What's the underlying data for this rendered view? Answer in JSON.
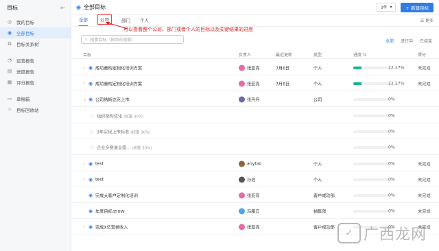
{
  "sidebar": {
    "title": "目标",
    "items": [
      {
        "label": "我的目标",
        "icon": "target-icon"
      },
      {
        "label": "全部目标",
        "icon": "goal-icon",
        "active": true
      },
      {
        "label": "目标关系树",
        "icon": "tree-icon"
      },
      {
        "label": "运营报告",
        "icon": "report-icon"
      },
      {
        "label": "进度报告",
        "icon": "progress-report-icon"
      },
      {
        "label": "评分报告",
        "icon": "score-report-icon"
      },
      {
        "label": "草稿箱",
        "icon": "draft-icon"
      },
      {
        "label": "目标回收站",
        "icon": "recycle-icon"
      }
    ]
  },
  "header": {
    "title": "全部目标",
    "period": "3年",
    "new_button": "+ 新建目标"
  },
  "tabs": [
    {
      "label": "全部",
      "active": true
    },
    {
      "label": "公司",
      "boxed": true
    },
    {
      "label": "部门"
    },
    {
      "label": "个人"
    }
  ],
  "more_label": "☰ 更多",
  "annotation": "可以查看整个公司、部门或者个人的目标以及关键结果的进度",
  "search": {
    "placeholder": "搜索目标（按回车搜索）"
  },
  "filters": [
    "全部",
    "进行中",
    "已结束"
  ],
  "columns": {
    "goal": "目标",
    "owner": "负责人",
    "updated": "最近更新",
    "type": "类型",
    "progress": "进度 ⇅",
    "score": "得分"
  },
  "rows": [
    {
      "name": "成功重构定制化培训方案",
      "owner": "张亚亮",
      "avatar_color": "#e86aa8",
      "updated": "7月6日",
      "type": "个人",
      "progress": 22.27,
      "progress_label": "22.27%",
      "status": "未完成",
      "kind": "goal",
      "expand": true
    },
    {
      "name": "成功重构定制化培训方案",
      "owner": "张亚亮",
      "avatar_color": "#e86aa8",
      "updated": "7月6日",
      "type": "个人",
      "progress": 22.27,
      "progress_label": "22.27%",
      "status": "未完成",
      "kind": "goal",
      "expand": true
    },
    {
      "name": "公司纳斯达克上市",
      "owner": "张丹丹",
      "avatar_color": "#6b6aa8",
      "updated": "",
      "type": "公司",
      "progress": 0,
      "progress_label": "0%",
      "status": "",
      "kind": "goal",
      "expand": true,
      "open": true
    },
    {
      "name": "组织架构优化",
      "sub": "(权重 30%)",
      "owner": "",
      "avatar_color": "",
      "updated": "",
      "type": "",
      "progress": 0,
      "progress_label": "0%",
      "status": "",
      "kind": "kr"
    },
    {
      "name": "3年实现上市标准",
      "sub": "(权重 30%)",
      "owner": "",
      "avatar_color": "",
      "updated": "",
      "type": "",
      "progress": 0,
      "progress_label": "0%",
      "status": "",
      "kind": "kr"
    },
    {
      "name": "企业多赛道全面...",
      "sub": "(权重 30%)",
      "owner": "",
      "avatar_color": "",
      "updated": "",
      "type": "",
      "progress": 0,
      "progress_label": "0%",
      "status": "",
      "kind": "kr"
    },
    {
      "name": "test",
      "owner": "anytao",
      "avatar_color": "#8a6a3a",
      "updated": "",
      "type": "个人",
      "progress": 0,
      "progress_label": "0%",
      "status": "未完成",
      "kind": "goal",
      "expand": true
    },
    {
      "name": "test",
      "owner": "孙浩",
      "avatar_color": "#555555",
      "updated": "",
      "type": "个人",
      "progress": 0,
      "progress_label": "0%",
      "status": "未完成",
      "kind": "goal",
      "expand": true
    },
    {
      "name": "完成大客户定制化培训",
      "owner": "张亚亮",
      "avatar_color": "#e86aa8",
      "updated": "",
      "type": "客户成功部",
      "progress": 0,
      "progress_label": "0%",
      "status": "未完成",
      "kind": "goal",
      "expand": false
    },
    {
      "name": "年度目标450W",
      "owner": "冯雁云",
      "avatar_color": "#4aa8e8",
      "updated": "",
      "type": "销售部",
      "progress": 0,
      "progress_label": "0%",
      "status": "未完成",
      "kind": "goal",
      "expand": false
    },
    {
      "name": "完成X亿营销收入",
      "owner": "张亚亮",
      "avatar_color": "#e86aa8",
      "updated": "",
      "type": "客户成功部",
      "progress": 0,
      "progress_label": "0%",
      "status": "未完成",
      "kind": "goal",
      "expand": true
    }
  ],
  "watermark": {
    "logo": "✓",
    "text": "广西龙网"
  },
  "colors": {
    "accent": "#2f7de1",
    "progress": "#20b58a",
    "annotation": "#e02020"
  }
}
